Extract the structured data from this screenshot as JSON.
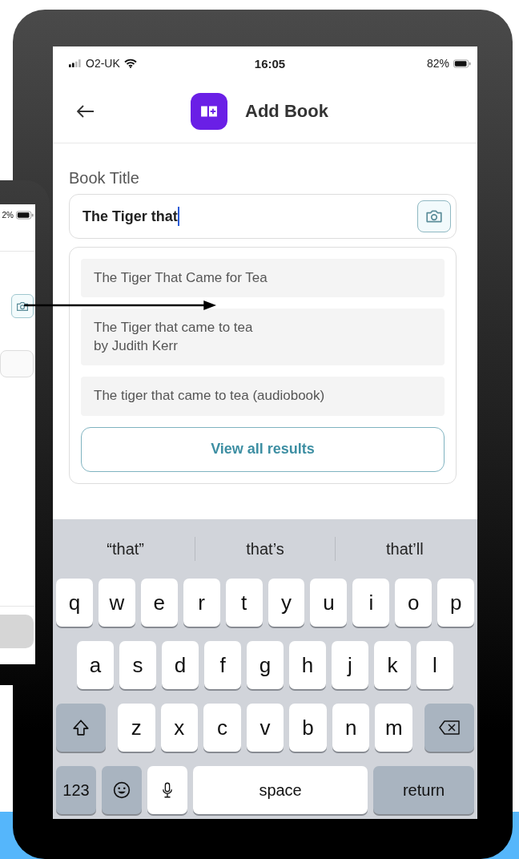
{
  "back_phone": {
    "status_bar": {
      "battery": "2%"
    }
  },
  "phone": {
    "status_bar": {
      "carrier": "O2-UK",
      "time": "16:05",
      "battery": "82%"
    },
    "header": {
      "title": "Add Book"
    },
    "book_title_field": {
      "label": "Book Title",
      "value": "The Tiger that"
    },
    "suggestions": [
      {
        "title": "The Tiger That Came for Tea"
      },
      {
        "title": "The Tiger that came to tea",
        "subtitle": "by Judith Kerr"
      },
      {
        "title": "The tiger that came to tea (audiobook)"
      }
    ],
    "view_all_button": "View all results",
    "keyboard": {
      "predictions": [
        "“that”",
        "that’s",
        "that’ll"
      ],
      "top_row": [
        {
          "kind": "letter",
          "label": "q"
        },
        {
          "kind": "letter",
          "label": "w"
        },
        {
          "kind": "letter",
          "label": "e"
        },
        {
          "kind": "letter",
          "label": "r"
        },
        {
          "kind": "letter",
          "label": "t"
        },
        {
          "kind": "letter",
          "label": "y"
        },
        {
          "kind": "letter",
          "label": "u"
        },
        {
          "kind": "letter",
          "label": "i"
        },
        {
          "kind": "letter",
          "label": "o"
        },
        {
          "kind": "letter",
          "label": "p"
        }
      ],
      "home_row": [
        {
          "kind": "letter",
          "label": "a"
        },
        {
          "kind": "letter",
          "label": "s"
        },
        {
          "kind": "letter",
          "label": "d"
        },
        {
          "kind": "letter",
          "label": "f"
        },
        {
          "kind": "letter",
          "label": "g"
        },
        {
          "kind": "letter",
          "label": "h"
        },
        {
          "kind": "letter",
          "label": "j"
        },
        {
          "kind": "letter",
          "label": "k"
        },
        {
          "kind": "letter",
          "label": "l"
        }
      ],
      "bottom_row": [
        {
          "kind": "shift"
        },
        {
          "kind": "letter",
          "label": "z"
        },
        {
          "kind": "letter",
          "label": "x"
        },
        {
          "kind": "letter",
          "label": "c"
        },
        {
          "kind": "letter",
          "label": "v"
        },
        {
          "kind": "letter",
          "label": "b"
        },
        {
          "kind": "letter",
          "label": "n"
        },
        {
          "kind": "letter",
          "label": "m"
        },
        {
          "kind": "delete"
        }
      ],
      "function_row": [
        {
          "kind": "mode",
          "label": "123"
        },
        {
          "kind": "emoji"
        },
        {
          "kind": "mic"
        },
        {
          "kind": "space",
          "label": "space"
        },
        {
          "kind": "return",
          "label": "return"
        }
      ]
    }
  }
}
